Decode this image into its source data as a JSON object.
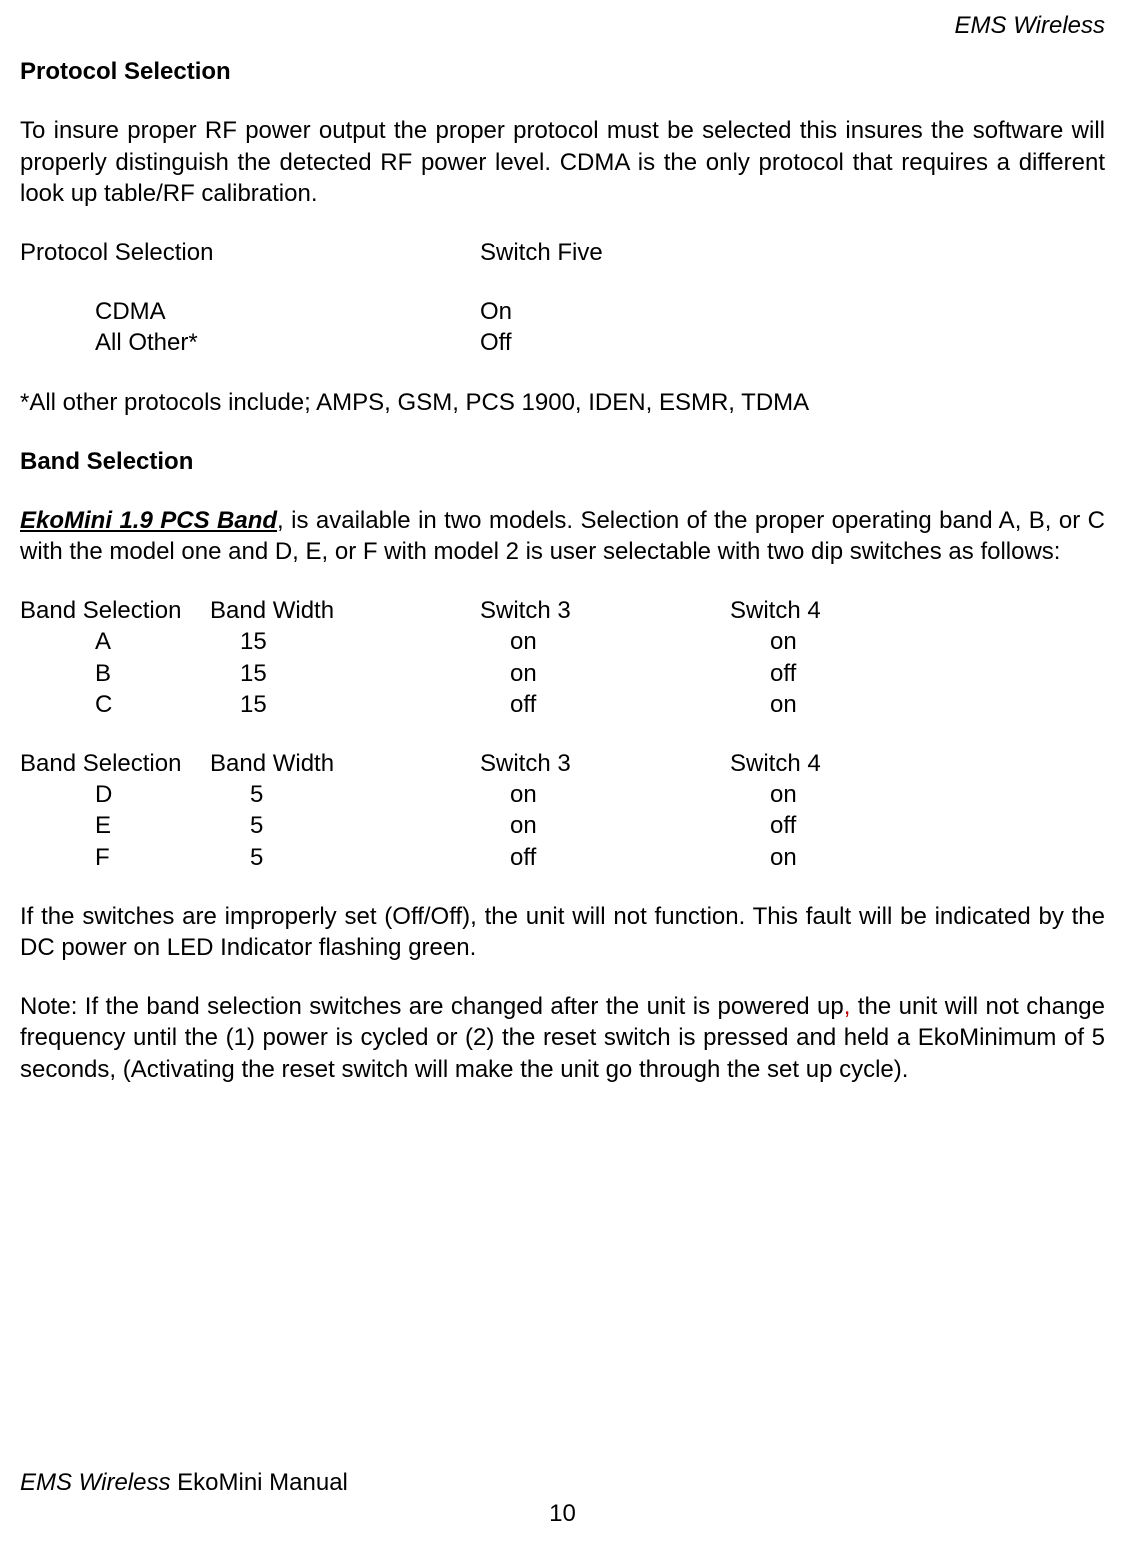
{
  "header": {
    "right": "EMS Wireless"
  },
  "section1": {
    "title": "Protocol Selection",
    "intro": "To insure proper RF power output the proper protocol must be selected this insures the software will properly distinguish the detected RF power level.  CDMA is the only protocol that requires a different look up table/RF calibration.",
    "table_header_left": "Protocol Selection",
    "table_header_right": "Switch Five",
    "rows": [
      {
        "name": "CDMA",
        "switch": "On"
      },
      {
        "name": "All Other*",
        "switch": "Off"
      }
    ],
    "footnote": "*All other protocols include; AMPS, GSM, PCS 1900, IDEN, ESMR, TDMA"
  },
  "section2": {
    "title": "Band Selection",
    "lead_bold": "EkoMini 1.9 PCS Band",
    "lead_rest": ", is available in two models.  Selection of the proper operating band A, B, or C with the model one and D, E, or F with model 2 is user selectable with two dip switches as follows:",
    "table1": {
      "h1": "Band Selection",
      "h2": "Band Width",
      "h3": "Switch 3",
      "h4": "Switch 4",
      "rows": [
        {
          "band": "A",
          "width": "15",
          "s3": "on",
          "s4": "on"
        },
        {
          "band": "B",
          "width": "15",
          "s3": "on",
          "s4": "off"
        },
        {
          "band": "C",
          "width": "15",
          "s3": "off",
          "s4": "on"
        }
      ]
    },
    "table2": {
      "h1": "Band Selection",
      "h2": "Band Width",
      "h3": "Switch 3",
      "h4": "Switch 4",
      "rows": [
        {
          "band": "D",
          "width": "5",
          "s3": "on",
          "s4": "on"
        },
        {
          "band": "E",
          "width": "5",
          "s3": "on",
          "s4": "off"
        },
        {
          "band": "F",
          "width": "5",
          "s3": "off",
          "s4": "on"
        }
      ]
    },
    "fault_para": "If the switches are improperly set (Off/Off), the unit will not function.  This fault will be indicated by the DC power on LED Indicator flashing green.",
    "note_prefix": "Note: If the band selection switches are changed after the unit is powered up",
    "note_comma": ",",
    "note_suffix": " the unit will not change frequency until the (1) power is cycled or (2) the reset switch is pressed and held a EkoMinimum of 5 seconds, (Activating the reset switch will make the unit go through the set up cycle)."
  },
  "footer": {
    "title_italic": "EMS Wireless",
    "title_rest": " EkoMini Manual",
    "page": "10"
  }
}
